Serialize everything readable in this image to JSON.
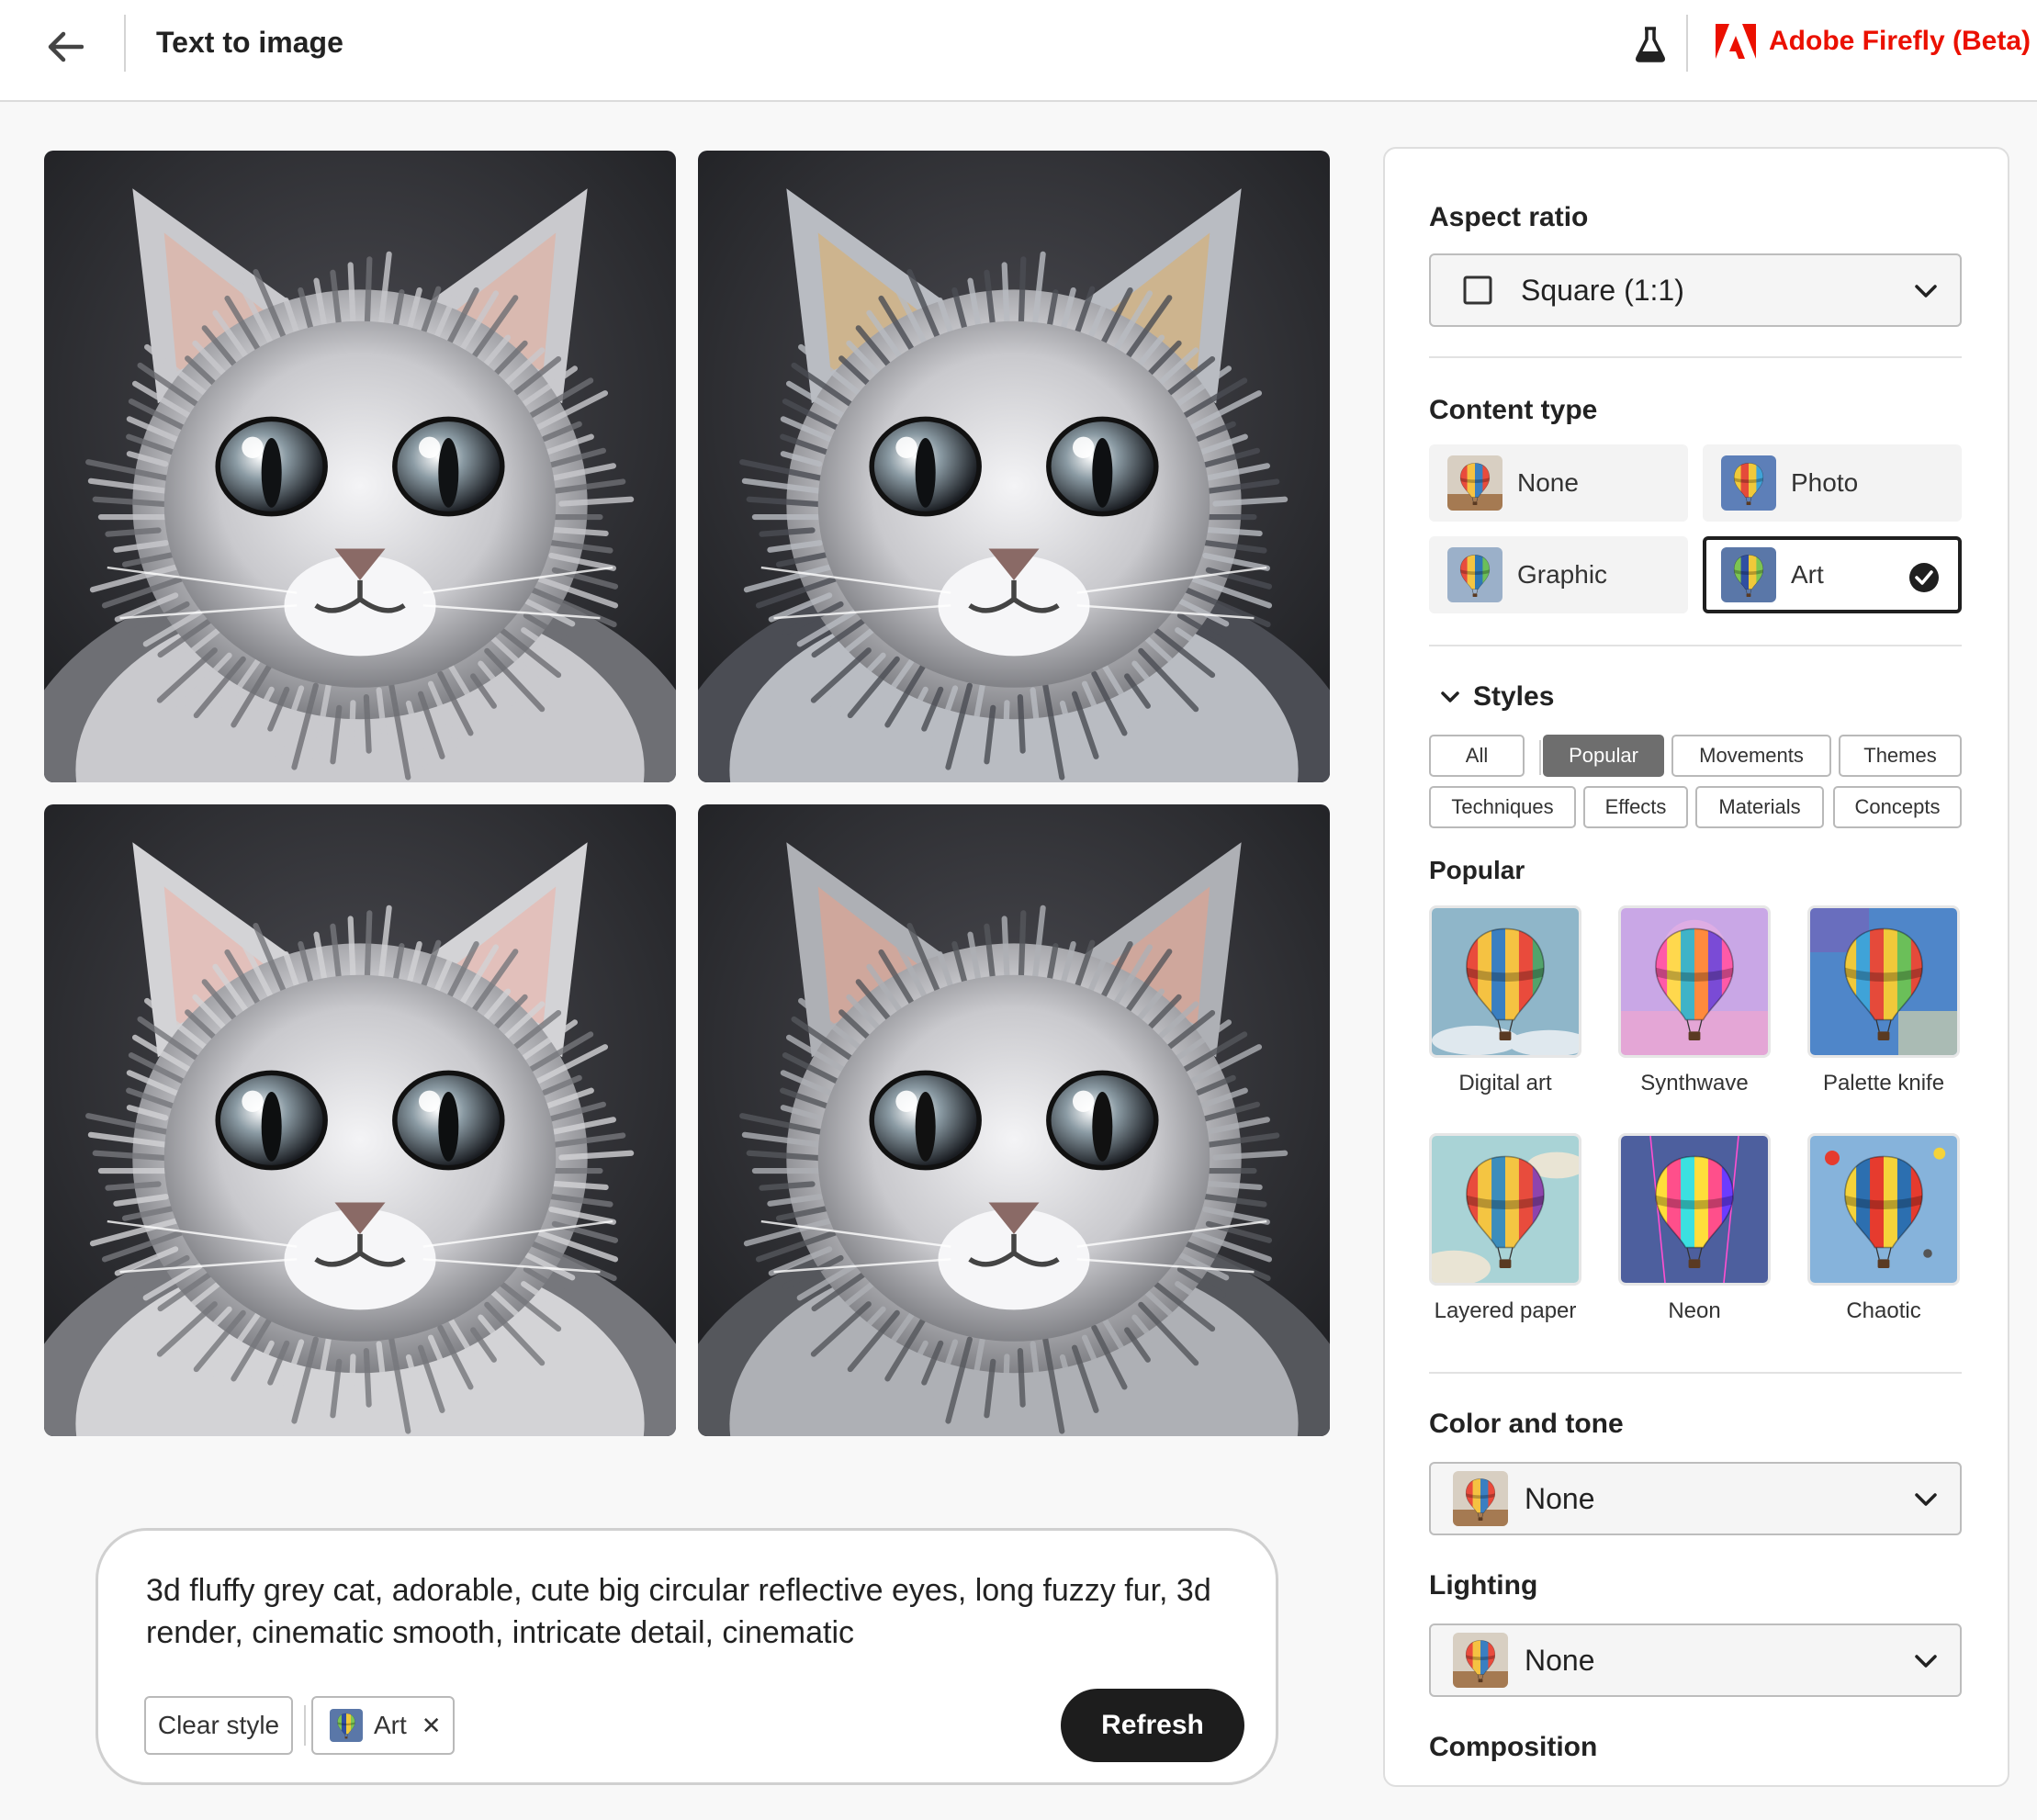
{
  "header": {
    "title": "Text to image",
    "brand": "Adobe Firefly (Beta)",
    "back_icon": "arrow-left-icon",
    "labs_icon": "flask-icon",
    "brand_color": "#eb1000"
  },
  "gallery": {
    "images": [
      {
        "label": "Generated image 1",
        "subject": "cat"
      },
      {
        "label": "Generated image 2",
        "subject": "cat"
      },
      {
        "label": "Generated image 3",
        "subject": "cat"
      },
      {
        "label": "Generated image 4",
        "subject": "cat"
      }
    ]
  },
  "prompt": {
    "text": "3d fluffy grey cat, adorable, cute big circular reflective eyes, long fuzzy fur, 3d render, cinematic smooth, intricate detail, cinematic",
    "clear_style_label": "Clear style",
    "applied_style": "Art",
    "remove_icon": "close-icon",
    "refresh_label": "Refresh"
  },
  "panel": {
    "aspect_ratio": {
      "title": "Aspect ratio",
      "value": "Square (1:1)"
    },
    "content_type": {
      "title": "Content type",
      "options": [
        {
          "label": "None",
          "selected": false
        },
        {
          "label": "Photo",
          "selected": false
        },
        {
          "label": "Graphic",
          "selected": false
        },
        {
          "label": "Art",
          "selected": true
        }
      ]
    },
    "styles": {
      "title": "Styles",
      "tabs": [
        {
          "label": "All",
          "active": false
        },
        {
          "label": "Popular",
          "active": true
        },
        {
          "label": "Movements",
          "active": false
        },
        {
          "label": "Themes",
          "active": false
        },
        {
          "label": "Techniques",
          "active": false
        },
        {
          "label": "Effects",
          "active": false
        },
        {
          "label": "Materials",
          "active": false
        },
        {
          "label": "Concepts",
          "active": false
        }
      ],
      "group_title": "Popular",
      "items": [
        {
          "label": "Digital art"
        },
        {
          "label": "Synthwave"
        },
        {
          "label": "Palette knife"
        },
        {
          "label": "Layered paper"
        },
        {
          "label": "Neon"
        },
        {
          "label": "Chaotic"
        }
      ]
    },
    "color_tone": {
      "title": "Color and tone",
      "value": "None"
    },
    "lighting": {
      "title": "Lighting",
      "value": "None"
    },
    "composition": {
      "title": "Composition"
    }
  }
}
